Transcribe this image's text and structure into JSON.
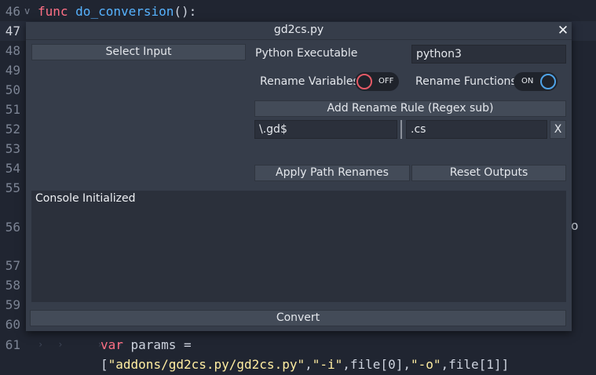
{
  "editor": {
    "lines": [
      {
        "number": "46",
        "parts": [
          {
            "text": "func ",
            "cls": "kw"
          },
          {
            "text": "do_conversion",
            "cls": "fn"
          },
          {
            "text": "():",
            "cls": ""
          }
        ],
        "fold": "v"
      },
      {
        "number": "47",
        "current": true,
        "parts": []
      },
      {
        "number": "48",
        "parts": []
      },
      {
        "number": "49",
        "parts": []
      },
      {
        "number": "50",
        "parts": []
      },
      {
        "number": "51",
        "parts": []
      },
      {
        "number": "52",
        "parts": []
      },
      {
        "number": "53",
        "parts": []
      },
      {
        "number": "54",
        "parts": []
      },
      {
        "number": "55",
        "parts": []
      },
      {
        "number": "56",
        "parts": []
      },
      {
        "number": "57",
        "parts": []
      },
      {
        "number": "58",
        "parts": []
      },
      {
        "number": "59",
        "parts": []
      },
      {
        "number": "60",
        "parts": []
      },
      {
        "number": "61",
        "tabs": "›› ››",
        "parts": [
          {
            "text": "var ",
            "cls": "kw"
          },
          {
            "text": "params =",
            "cls": ""
          }
        ]
      },
      {
        "number": "",
        "parts": [
          {
            "text": "[",
            "cls": ""
          },
          {
            "text": "\"addons/gd2cs.py/gd2cs.py\"",
            "cls": "str"
          },
          {
            "text": ",",
            "cls": ""
          },
          {
            "text": "\"-i\"",
            "cls": "str"
          },
          {
            "text": ",file[0],",
            "cls": ""
          },
          {
            "text": "\"-o\"",
            "cls": "str"
          },
          {
            "text": ",file[1]]",
            "cls": ""
          }
        ]
      }
    ],
    "edge_glyph": "o"
  },
  "dialog": {
    "title": "gd2cs.py",
    "close_label": "✕",
    "select_input_label": "Select Input",
    "python_executable_label": "Python Executable",
    "python_executable_value": "python3",
    "rename_variables_label": "Rename Variables",
    "rename_variables_state": "OFF",
    "rename_functions_label": "Rename Functions",
    "rename_functions_state": "ON",
    "add_rename_rule_label": "Add Rename Rule (Regex sub)",
    "rule": {
      "pattern": "\\.gd$",
      "replacement": ".cs",
      "remove_label": "X"
    },
    "apply_path_renames_label": "Apply Path Renames",
    "reset_outputs_label": "Reset Outputs",
    "console_text": "Console Initialized",
    "convert_label": "Convert"
  },
  "colors": {
    "editor_bg": "#202531",
    "dialog_bg": "#363d4a",
    "field_bg": "#2b303b",
    "toggle_off_accent": "#e35a66",
    "toggle_on_accent": "#4fa3e8",
    "keyword": "#ff7085",
    "function": "#57b3ff",
    "string": "#ffeda1"
  },
  "icons": {
    "fold": "chevron-down-icon",
    "tab_marker": "tab-indent-icon",
    "close": "close-icon"
  }
}
